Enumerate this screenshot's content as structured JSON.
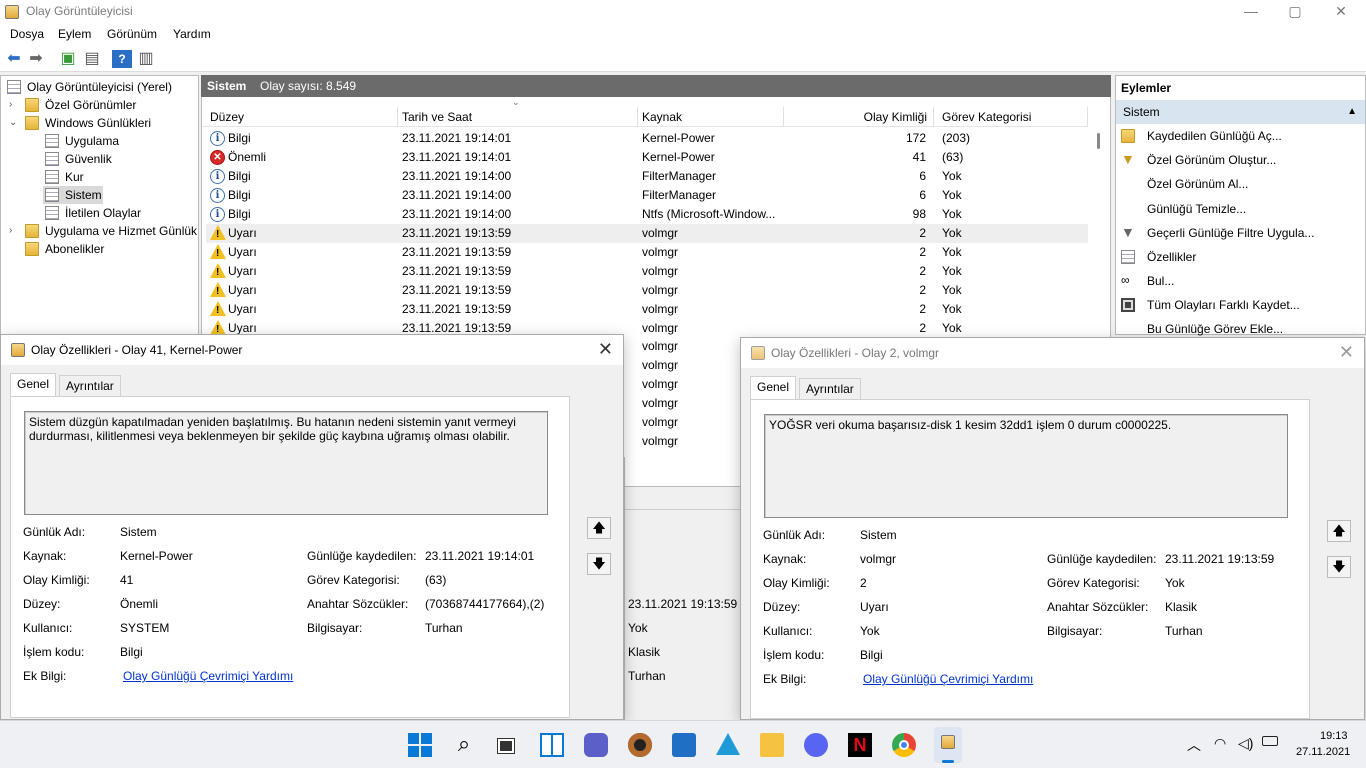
{
  "window": {
    "title": "Olay Görüntüleyicisi",
    "min": "—",
    "max": "▢",
    "close": "✕"
  },
  "menu": [
    "Dosya",
    "Eylem",
    "Görünüm",
    "Yardım"
  ],
  "tree": [
    {
      "label": "Olay Görüntüleyicisi (Yerel)"
    },
    {
      "label": "Özel Görünümler"
    },
    {
      "label": "Windows Günlükleri"
    },
    {
      "label": "Uygulama"
    },
    {
      "label": "Güvenlik"
    },
    {
      "label": "Kur"
    },
    {
      "label": "Sistem"
    },
    {
      "label": "İletilen Olaylar"
    },
    {
      "label": "Uygulama ve Hizmet Günlük"
    },
    {
      "label": "Abonelikler"
    }
  ],
  "list": {
    "title": "Sistem",
    "count": "Olay sayısı: 8.549",
    "columns": [
      "Düzey",
      "Tarih ve Saat",
      "Kaynak",
      "Olay Kimliği",
      "Görev Kategorisi"
    ],
    "rows": [
      {
        "level": "Bilgi",
        "type": "info",
        "date": "23.11.2021 19:14:01",
        "source": "Kernel-Power",
        "id": "172",
        "cat": "(203)"
      },
      {
        "level": "Önemli",
        "type": "err",
        "date": "23.11.2021 19:14:01",
        "source": "Kernel-Power",
        "id": "41",
        "cat": "(63)"
      },
      {
        "level": "Bilgi",
        "type": "info",
        "date": "23.11.2021 19:14:00",
        "source": "FilterManager",
        "id": "6",
        "cat": "Yok"
      },
      {
        "level": "Bilgi",
        "type": "info",
        "date": "23.11.2021 19:14:00",
        "source": "FilterManager",
        "id": "6",
        "cat": "Yok"
      },
      {
        "level": "Bilgi",
        "type": "info",
        "date": "23.11.2021 19:14:00",
        "source": "Ntfs (Microsoft-Window...",
        "id": "98",
        "cat": "Yok"
      },
      {
        "level": "Uyarı",
        "type": "warn",
        "date": "23.11.2021 19:13:59",
        "source": "volmgr",
        "id": "2",
        "cat": "Yok"
      },
      {
        "level": "Uyarı",
        "type": "warn",
        "date": "23.11.2021 19:13:59",
        "source": "volmgr",
        "id": "2",
        "cat": "Yok"
      },
      {
        "level": "Uyarı",
        "type": "warn",
        "date": "23.11.2021 19:13:59",
        "source": "volmgr",
        "id": "2",
        "cat": "Yok"
      },
      {
        "level": "Uyarı",
        "type": "warn",
        "date": "23.11.2021 19:13:59",
        "source": "volmgr",
        "id": "2",
        "cat": "Yok"
      },
      {
        "level": "Uyarı",
        "type": "warn",
        "date": "23.11.2021 19:13:59",
        "source": "volmgr",
        "id": "2",
        "cat": "Yok"
      },
      {
        "level": "Uyarı",
        "type": "warn",
        "date": "23.11.2021 19:13:59",
        "source": "volmgr",
        "id": "2",
        "cat": "Yok"
      }
    ],
    "hidden_sources": [
      "volmgr",
      "volmgr",
      "volmgr",
      "volmgr",
      "volmgr",
      "volmgr"
    ]
  },
  "lower_details": [
    "23.11.2021 19:13:59",
    "Yok",
    "Klasik",
    "Turhan"
  ],
  "actions": {
    "header": "Eylemler",
    "section": "Sistem",
    "items": [
      {
        "label": "Kaydedilen Günlüğü Aç...",
        "icon": "folder-open-icon"
      },
      {
        "label": "Özel Görünüm Oluştur...",
        "icon": "filter-icon"
      },
      {
        "label": "Özel Görünüm Al...",
        "icon": "none"
      },
      {
        "label": "Günlüğü Temizle...",
        "icon": "none"
      },
      {
        "label": "Geçerli Günlüğe Filtre Uygula...",
        "icon": "filter-icon"
      },
      {
        "label": "Özellikler",
        "icon": "properties-icon"
      },
      {
        "label": "Bul...",
        "icon": "binoculars-icon"
      },
      {
        "label": "Tüm Olayları Farklı Kaydet...",
        "icon": "save-icon"
      },
      {
        "label": "Bu Günlüğe Görev Ekle...",
        "icon": "none"
      }
    ]
  },
  "dialog1": {
    "title": "Olay Özellikleri - Olay 41, Kernel-Power",
    "tabs": [
      "Genel",
      "Ayrıntılar"
    ],
    "description": "Sistem düzgün kapatılmadan yeniden başlatılmış. Bu hatanın nedeni sistemin yanıt vermeyi durdurması, kilitlenmesi veya beklenmeyen bir şekilde güç kaybına uğramış olması olabilir.",
    "left": [
      {
        "k": "Günlük Adı:",
        "v": "Sistem"
      },
      {
        "k": "Kaynak:",
        "v": "Kernel-Power"
      },
      {
        "k": "Olay Kimliği:",
        "v": "41"
      },
      {
        "k": "Düzey:",
        "v": "Önemli"
      },
      {
        "k": "Kullanıcı:",
        "v": "SYSTEM"
      },
      {
        "k": "İşlem kodu:",
        "v": "Bilgi"
      },
      {
        "k": "Ek Bilgi:",
        "v": "Olay Günlüğü Çevrimiçi Yardımı"
      }
    ],
    "right": [
      {
        "k": "Günlüğe kaydedilen:",
        "v": "23.11.2021 19:14:01"
      },
      {
        "k": "Görev Kategorisi:",
        "v": "(63)"
      },
      {
        "k": "Anahtar Sözcükler:",
        "v": "(70368744177664),(2)"
      },
      {
        "k": "Bilgisayar:",
        "v": "Turhan"
      }
    ]
  },
  "dialog2": {
    "title": "Olay Özellikleri - Olay 2, volmgr",
    "tabs": [
      "Genel",
      "Ayrıntılar"
    ],
    "description": "YOĞSR veri okuma başarısız-disk 1 kesim 32dd1 işlem 0 durum c0000225.",
    "left": [
      {
        "k": "Günlük Adı:",
        "v": "Sistem"
      },
      {
        "k": "Kaynak:",
        "v": "volmgr"
      },
      {
        "k": "Olay Kimliği:",
        "v": "2"
      },
      {
        "k": "Düzey:",
        "v": "Uyarı"
      },
      {
        "k": "Kullanıcı:",
        "v": "Yok"
      },
      {
        "k": "İşlem kodu:",
        "v": "Bilgi"
      },
      {
        "k": "Ek Bilgi:",
        "v": "Olay Günlüğü Çevrimiçi Yardımı"
      }
    ],
    "right": [
      {
        "k": "Günlüğe kaydedilen:",
        "v": "23.11.2021 19:13:59"
      },
      {
        "k": "Görev Kategorisi:",
        "v": "Yok"
      },
      {
        "k": "Anahtar Sözcükler:",
        "v": "Klasik"
      },
      {
        "k": "Bilgisayar:",
        "v": "Turhan"
      }
    ]
  },
  "taskbar": {
    "apps": [
      "start-icon",
      "search-icon",
      "task-view-icon",
      "widgets-icon",
      "chat-icon",
      "media-icon",
      "store-icon",
      "azure-icon",
      "explorer-icon",
      "discord-icon",
      "netflix-icon",
      "chrome-icon",
      "event-viewer-icon"
    ],
    "time": "19:13",
    "date": "27.11.2021",
    "tray_chevron": "︿"
  },
  "colors": {
    "accent": "#0067c0",
    "selection": "#d8e4f0",
    "link": "#0033cc"
  }
}
